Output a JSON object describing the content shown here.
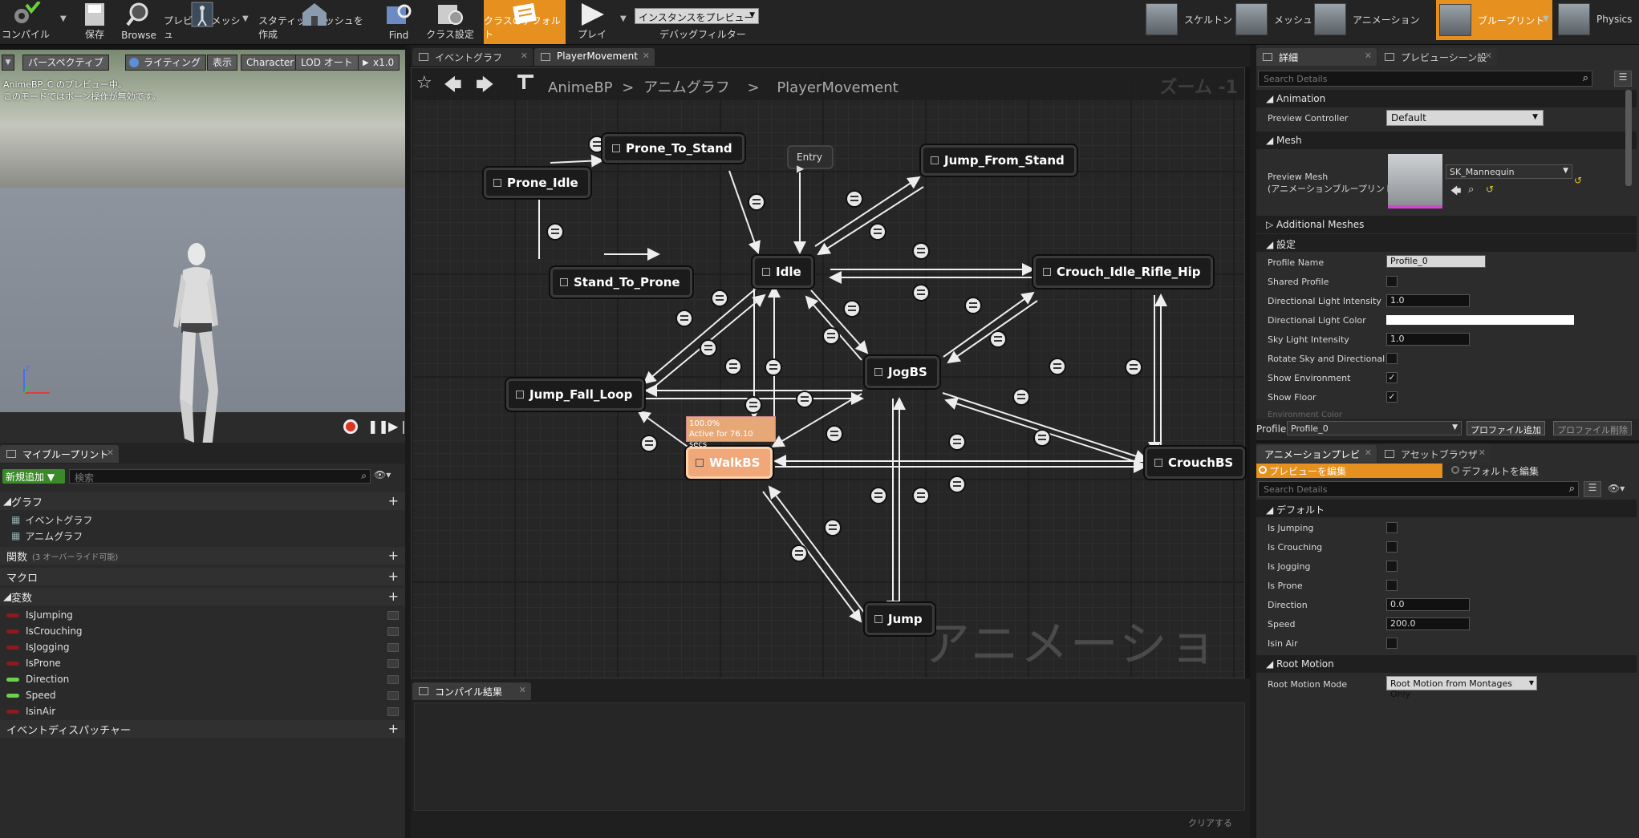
{
  "toolbar": {
    "compile": "コンパイル",
    "save": "保存",
    "browse": "Browse",
    "preview_mesh": "プレビューメッシュ",
    "make_static_mesh": "スタティックメッシュを作成",
    "find": "Find",
    "class_settings": "クラス設定",
    "class_defaults": "クラスのデフォルト",
    "play": "プレイ",
    "preview_instance": "インスタンスをプレビュー",
    "debug_filter": "デバッグフィルター",
    "modes": [
      "スケルトン",
      "メッシュ",
      "アニメーション",
      "ブループリント",
      "Physics"
    ]
  },
  "viewport": {
    "perspective": "パースペクティブ",
    "lighting": "ライティング",
    "show": "表示",
    "character": "Character",
    "lod": "LOD オート",
    "speed": "x1.0",
    "info_line1": "AnimeBP_C のプレビュー中。",
    "info_line2": "このモードではボーン操作が無効です。"
  },
  "my_blueprint": {
    "tab": "マイブループリント",
    "add_new": "新規追加",
    "search_placeholder": "検索",
    "graph_header": "グラフ",
    "graphs": [
      "イベントグラフ",
      "アニムグラフ"
    ],
    "functions": "関数",
    "functions_note": "(3 オーバーライド可能)",
    "macros": "マクロ",
    "variables_header": "変数",
    "dispatchers": "イベントディスパッチャー",
    "variables": [
      {
        "name": "IsJumping",
        "color": "#8a1c1c"
      },
      {
        "name": "IsCrouching",
        "color": "#8a1c1c"
      },
      {
        "name": "IsJogging",
        "color": "#8a1c1c"
      },
      {
        "name": "IsProne",
        "color": "#8a1c1c"
      },
      {
        "name": "Direction",
        "color": "#6ad14a"
      },
      {
        "name": "Speed",
        "color": "#6ad14a"
      },
      {
        "name": "IsinAir",
        "color": "#8a1c1c"
      }
    ]
  },
  "graph": {
    "tabs": [
      "イベントグラフ",
      "PlayerMovement"
    ],
    "breadcrumb": [
      "AnimeBP",
      "アニムグラフ",
      "PlayerMovement"
    ],
    "zoom": "ズーム -1",
    "watermark": "アニメーション",
    "entry": "Entry",
    "nodes": {
      "prone_to_stand": "Prone_To_Stand",
      "prone_idle": "Prone_Idle",
      "jump_from_stand": "Jump_From_Stand",
      "idle": "Idle",
      "stand_to_prone": "Stand_To_Prone",
      "crouch_idle": "Crouch_Idle_Rifle_Hip",
      "jogbs": "JogBS",
      "jump_fall_loop": "Jump_Fall_Loop",
      "walkbs": "WalkBS",
      "crouchbs": "CrouchBS",
      "jump": "Jump"
    },
    "tooltip_line1": "100.0%",
    "tooltip_line2": "Active for 76.10 secs"
  },
  "compile_results": {
    "tab": "コンパイル結果",
    "clear": "クリアする"
  },
  "details": {
    "tabs": [
      "詳細",
      "プレビューシーン設"
    ],
    "search_placeholder": "Search Details",
    "animation_header": "Animation",
    "preview_controller_label": "Preview Controller",
    "preview_controller_value": "Default",
    "mesh_header": "Mesh",
    "preview_mesh_label1": "Preview Mesh",
    "preview_mesh_label2": "(アニメーションブループリント)",
    "preview_mesh_value": "SK_Mannequin",
    "additional_meshes": "Additional Meshes",
    "settings_header": "設定",
    "profile_name_label": "Profile Name",
    "profile_name_value": "Profile_0",
    "shared_profile": "Shared Profile",
    "dir_light_intensity_label": "Directional Light Intensity",
    "dir_light_intensity_value": "1.0",
    "dir_light_color": "Directional Light Color",
    "sky_light_label": "Sky Light Intensity",
    "sky_light_value": "1.0",
    "rotate_sky": "Rotate Sky and Directional Li",
    "show_env": "Show Environment",
    "show_floor": "Show Floor",
    "env_color": "Environment Color",
    "profile_label": "Profile",
    "profile_value": "Profile_0",
    "add_profile": "プロファイル追加",
    "remove_profile": "プロファイル削除"
  },
  "anim_preview": {
    "tabs": [
      "アニメーションプレビュ",
      "アセットブラウザ"
    ],
    "edit_preview": "プレビューを編集",
    "edit_defaults": "デフォルトを編集",
    "search_placeholder": "Search Details",
    "default_header": "デフォルト",
    "is_jumping": "Is Jumping",
    "is_crouching": "Is Crouching",
    "is_jogging": "Is Jogging",
    "is_prone": "Is Prone",
    "direction_label": "Direction",
    "direction_value": "0.0",
    "speed_label": "Speed",
    "speed_value": "200.0",
    "isin_air": "Isin Air",
    "root_motion_header": "Root Motion",
    "root_motion_mode_label": "Root Motion Mode",
    "root_motion_mode_value": "Root Motion from Montages Only"
  }
}
